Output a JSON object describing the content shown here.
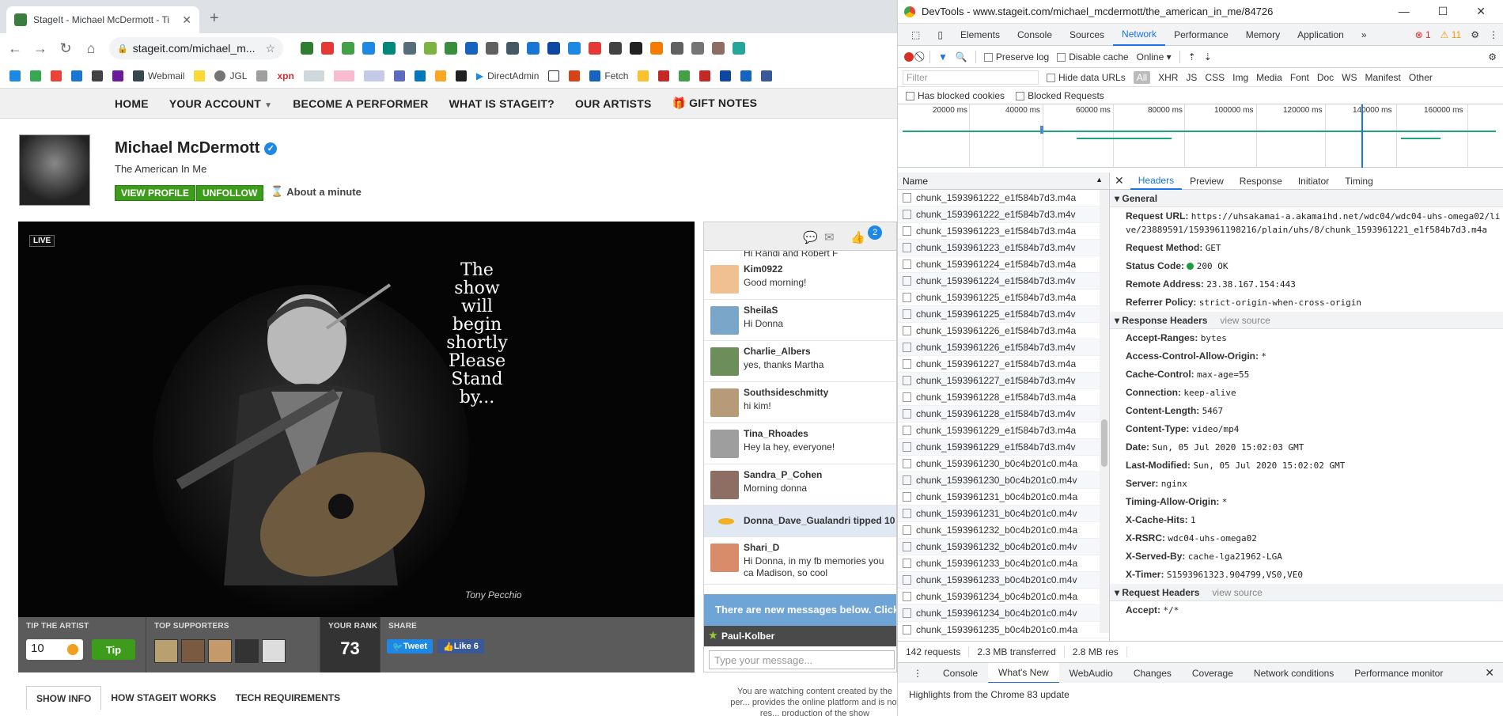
{
  "browser": {
    "tab_title": "StageIt - Michael McDermott - Ti",
    "url": "stageit.com/michael_m...",
    "bookmarks": [
      "Webmail",
      "JGL",
      "xpn",
      "DirectAdmin",
      "Fetch"
    ]
  },
  "site": {
    "nav": [
      "HOME",
      "YOUR ACCOUNT",
      "BECOME A PERFORMER",
      "WHAT IS STAGEIT?",
      "OUR ARTISTS",
      "GIFT NOTES"
    ],
    "artist_name": "Michael McDermott",
    "show_title": "The American In Me",
    "view_profile": "VIEW PROFILE",
    "unfollow": "UNFOLLOW",
    "timer": "About a minute",
    "live_badge": "LIVE",
    "video_text": "The\nshow\nwill\nbegin\nshortly\nPlease\nStand\nby...",
    "video_signature": "Tony Pecchio",
    "tip_label": "TIP THE ARTIST",
    "tip_value": "10",
    "tip_button": "Tip",
    "supporters_label": "TOP SUPPORTERS",
    "rank_label": "YOUR RANK",
    "rank_value": "73",
    "share_label": "SHARE",
    "tweet": "Tweet",
    "like": "Like 6",
    "tabs": [
      "SHOW INFO",
      "HOW STAGEIT WORKS",
      "TECH REQUIREMENTS"
    ],
    "disclaimer": "You are watching content created by the per... provides the online platform and is not res... production of the show"
  },
  "chat": {
    "badge_count": "2",
    "messages": [
      {
        "user": "Kim0922",
        "text": "Good morning!"
      },
      {
        "user": "SheilaS",
        "text": "Hi Donna"
      },
      {
        "user": "Charlie_Albers",
        "text": "yes, thanks Martha"
      },
      {
        "user": "Southsideschmitty",
        "text": "hi kim!"
      },
      {
        "user": "Tina_Rhoades",
        "text": "Hey la hey, everyone!"
      },
      {
        "user": "Sandra_P_Cohen",
        "text": "Morning donna"
      }
    ],
    "top_partial": "Hi Randi and Robert F",
    "tip_line": "Donna_Dave_Gualandri tipped 10",
    "last_msg": {
      "user": "Shari_D",
      "text": "Hi Donna, in my fb memories you ca Madison, so cool"
    },
    "new_messages": "There are new messages below. Click to s",
    "current_user": "Paul-Kolber",
    "input_placeholder": "Type your message..."
  },
  "devtools": {
    "title": "DevTools - www.stageit.com/michael_mcdermott/the_american_in_me/84726",
    "tabs": [
      "Elements",
      "Console",
      "Sources",
      "Network",
      "Performance",
      "Memory",
      "Application"
    ],
    "errors": "1",
    "warnings": "11",
    "preserve_log": "Preserve log",
    "disable_cache": "Disable cache",
    "throttle": "Online",
    "filter_placeholder": "Filter",
    "hide_data_urls": "Hide data URLs",
    "types": [
      "All",
      "XHR",
      "JS",
      "CSS",
      "Img",
      "Media",
      "Font",
      "Doc",
      "WS",
      "Manifest",
      "Other"
    ],
    "blocked": [
      "Has blocked cookies",
      "Blocked Requests"
    ],
    "ticks": [
      "20000 ms",
      "40000 ms",
      "60000 ms",
      "80000 ms",
      "100000 ms",
      "120000 ms",
      "140000 ms",
      "160000 ms"
    ],
    "name_header": "Name",
    "requests": [
      "chunk_1593961222_e1f584b7d3.m4a",
      "chunk_1593961222_e1f584b7d3.m4v",
      "chunk_1593961223_e1f584b7d3.m4a",
      "chunk_1593961223_e1f584b7d3.m4v",
      "chunk_1593961224_e1f584b7d3.m4a",
      "chunk_1593961224_e1f584b7d3.m4v",
      "chunk_1593961225_e1f584b7d3.m4a",
      "chunk_1593961225_e1f584b7d3.m4v",
      "chunk_1593961226_e1f584b7d3.m4a",
      "chunk_1593961226_e1f584b7d3.m4v",
      "chunk_1593961227_e1f584b7d3.m4a",
      "chunk_1593961227_e1f584b7d3.m4v",
      "chunk_1593961228_e1f584b7d3.m4a",
      "chunk_1593961228_e1f584b7d3.m4v",
      "chunk_1593961229_e1f584b7d3.m4a",
      "chunk_1593961229_e1f584b7d3.m4v",
      "chunk_1593961230_b0c4b201c0.m4a",
      "chunk_1593961230_b0c4b201c0.m4v",
      "chunk_1593961231_b0c4b201c0.m4a",
      "chunk_1593961231_b0c4b201c0.m4v",
      "chunk_1593961232_b0c4b201c0.m4a",
      "chunk_1593961232_b0c4b201c0.m4v",
      "chunk_1593961233_b0c4b201c0.m4a",
      "chunk_1593961233_b0c4b201c0.m4v",
      "chunk_1593961234_b0c4b201c0.m4a",
      "chunk_1593961234_b0c4b201c0.m4v",
      "chunk_1593961235_b0c4b201c0.m4a"
    ],
    "detail_tabs": [
      "Headers",
      "Preview",
      "Response",
      "Initiator",
      "Timing"
    ],
    "general_label": "General",
    "general": [
      {
        "k": "Request URL:",
        "v": "https://uhsakamai-a.akamaihd.net/wdc04/wdc04-uhs-omega02/live/23889591/1593961198216/plain/uhs/8/chunk_1593961221_e1f584b7d3.m4a"
      },
      {
        "k": "Request Method:",
        "v": "GET"
      },
      {
        "k": "Status Code:",
        "v": "200 OK"
      },
      {
        "k": "Remote Address:",
        "v": "23.38.167.154:443"
      },
      {
        "k": "Referrer Policy:",
        "v": "strict-origin-when-cross-origin"
      }
    ],
    "response_label": "Response Headers",
    "view_source": "view source",
    "response": [
      {
        "k": "Accept-Ranges:",
        "v": "bytes"
      },
      {
        "k": "Access-Control-Allow-Origin:",
        "v": "*"
      },
      {
        "k": "Cache-Control:",
        "v": "max-age=55"
      },
      {
        "k": "Connection:",
        "v": "keep-alive"
      },
      {
        "k": "Content-Length:",
        "v": "5467"
      },
      {
        "k": "Content-Type:",
        "v": "video/mp4"
      },
      {
        "k": "Date:",
        "v": "Sun, 05 Jul 2020 15:02:03 GMT"
      },
      {
        "k": "Last-Modified:",
        "v": "Sun, 05 Jul 2020 15:02:02 GMT"
      },
      {
        "k": "Server:",
        "v": "nginx"
      },
      {
        "k": "Timing-Allow-Origin:",
        "v": "*"
      },
      {
        "k": "X-Cache-Hits:",
        "v": "1"
      },
      {
        "k": "X-RSRC:",
        "v": "wdc04-uhs-omega02"
      },
      {
        "k": "X-Served-By:",
        "v": "cache-lga21962-LGA"
      },
      {
        "k": "X-Timer:",
        "v": "S1593961323.904799,VS0,VE0"
      }
    ],
    "request_label": "Request Headers",
    "request": [
      {
        "k": "Accept:",
        "v": "*/*"
      }
    ],
    "summary": [
      "142 requests",
      "2.3 MB transferred",
      "2.8 MB res"
    ],
    "drawer_tabs": [
      "Console",
      "What's New",
      "WebAudio",
      "Changes",
      "Coverage",
      "Network conditions",
      "Performance monitor"
    ],
    "whats_new": "Highlights from the Chrome 83 update"
  }
}
